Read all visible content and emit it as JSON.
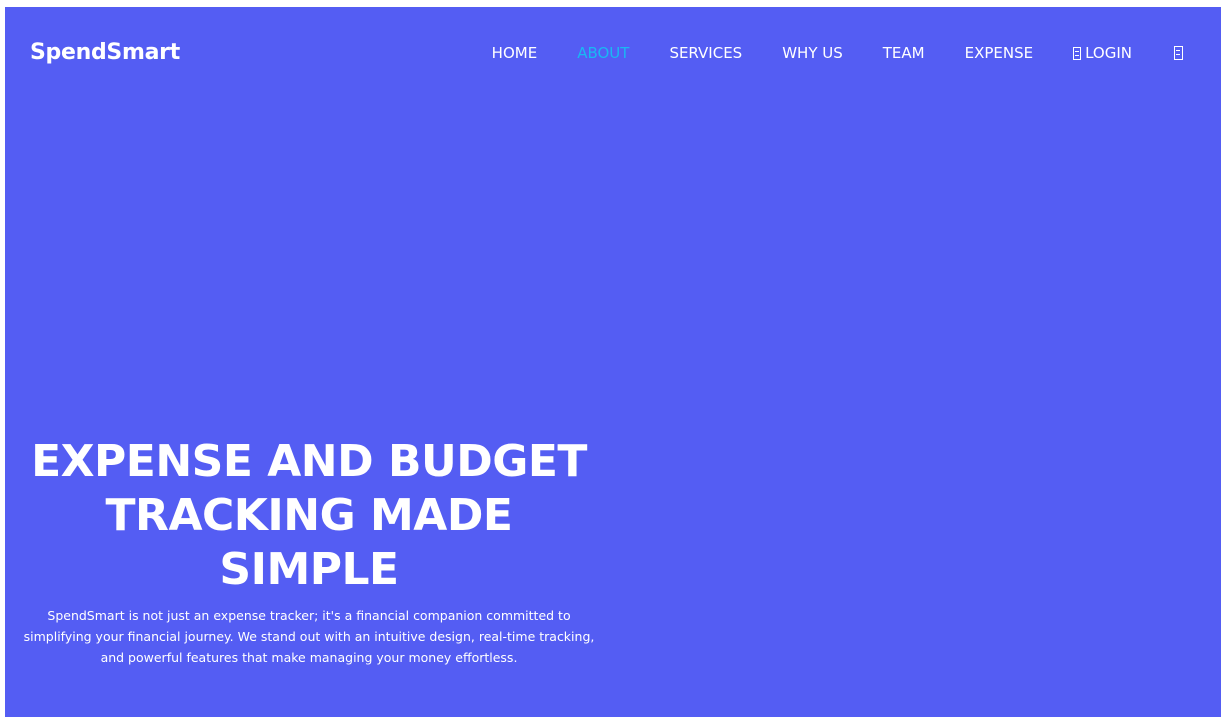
{
  "brand": {
    "name": "SpendSmart"
  },
  "nav": {
    "items": [
      {
        "label": "HOME",
        "active": false
      },
      {
        "label": "ABOUT",
        "active": true
      },
      {
        "label": "SERVICES",
        "active": false
      },
      {
        "label": "WHY US",
        "active": false
      },
      {
        "label": "TEAM",
        "active": false
      },
      {
        "label": "EXPENSE",
        "active": false
      }
    ],
    "login_label": "LOGIN",
    "login_icon": "missing-glyph-icon",
    "menu_icon": "missing-glyph-icon"
  },
  "hero": {
    "title_line1": "EXPENSE AND BUDGET",
    "title_line2": "TRACKING MADE SIMPLE",
    "description": "SpendSmart is not just an expense tracker; it's a financial companion committed to simplifying your financial journey. We stand out with an intuitive design, real-time tracking, and powerful features that make managing your money effortless."
  },
  "colors": {
    "background": "#545df3",
    "active_link": "#19b8f3",
    "text": "#ffffff"
  }
}
